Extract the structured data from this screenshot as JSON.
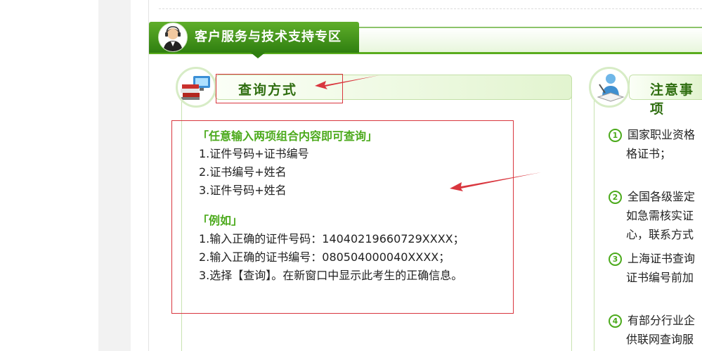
{
  "section": {
    "title": "客户服务与技术支持专区"
  },
  "query_panel": {
    "title": "查询方式",
    "combo_heading": "「任意输入两项组合内容即可查询」",
    "combo_items": [
      "1.证件号码+证书编号",
      "2.证书编号+姓名",
      "3.证件号码+姓名"
    ],
    "example_heading": "「例如」",
    "example_items": [
      "1.输入正确的证件号码：14040219660729XXXX；",
      "2.输入正确的证书编号：080504000040XXXX；",
      "3.选择【查询】。在新窗口中显示此考生的正确信息。"
    ]
  },
  "notes_panel": {
    "title": "注意事项",
    "items": [
      {
        "num": "1",
        "lines": [
          "国家职业资格",
          "格证书；"
        ]
      },
      {
        "num": "2",
        "lines": [
          "全国各级鉴定",
          "如急需核实证",
          "心，联系方式"
        ]
      },
      {
        "num": "3",
        "lines": [
          "上海证书查询",
          "证书编号前加"
        ]
      },
      {
        "num": "4",
        "lines": [
          "有部分行业企",
          "供联网查询服"
        ]
      }
    ]
  },
  "colors": {
    "accent_green": "#4caa1c",
    "dark_green": "#2f7f10",
    "annotation_red": "#d9363e"
  }
}
